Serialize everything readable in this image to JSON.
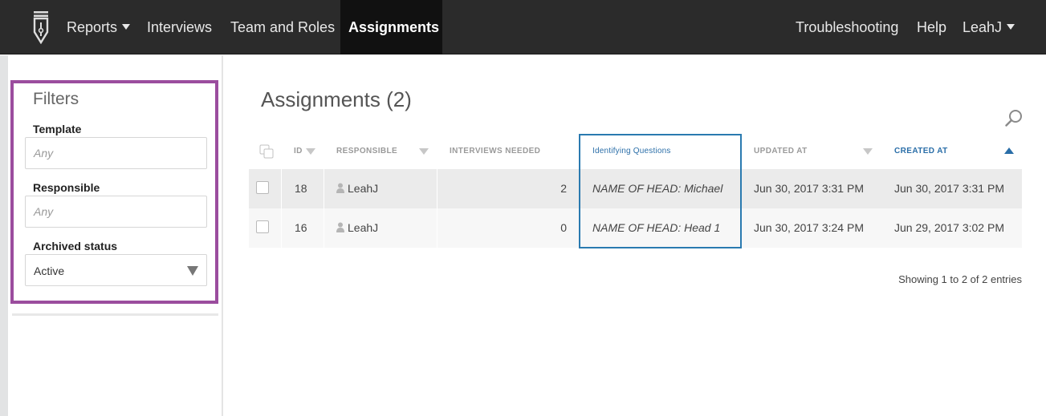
{
  "nav": {
    "logo_icon": "pen-nib-icon",
    "reports": "Reports",
    "interviews": "Interviews",
    "team_roles": "Team and Roles",
    "assignments": "Assignments",
    "troubleshooting": "Troubleshooting",
    "help": "Help",
    "user": "LeahJ"
  },
  "filters": {
    "title": "Filters",
    "template_label": "Template",
    "template_placeholder": "Any",
    "responsible_label": "Responsible",
    "responsible_placeholder": "Any",
    "archived_label": "Archived status",
    "archived_value": "Active"
  },
  "main": {
    "title": "Assignments (2)",
    "columns": {
      "id": "ID",
      "responsible": "RESPONSIBLE",
      "interviews_needed": "INTERVIEWS NEEDED",
      "identifying": "Identifying Questions",
      "updated": "UPDATED AT",
      "created": "CREATED AT"
    },
    "rows": [
      {
        "id": "18",
        "responsible": "LeahJ",
        "needed": "2",
        "identifying": "NAME OF HEAD: Michael",
        "updated": "Jun 30, 2017 3:31 PM",
        "created": "Jun 30, 2017 3:31 PM"
      },
      {
        "id": "16",
        "responsible": "LeahJ",
        "needed": "0",
        "identifying": "NAME OF HEAD: Head 1",
        "updated": "Jun 30, 2017 3:24 PM",
        "created": "Jun 29, 2017 3:02 PM"
      }
    ],
    "showing": "Showing 1 to 2 of 2 entries"
  },
  "colors": {
    "nav_bg": "#2b2b2b",
    "highlight_purple": "#9b4d9e",
    "highlight_blue": "#2a7ab0",
    "accent_blue": "#2a6ea8"
  }
}
